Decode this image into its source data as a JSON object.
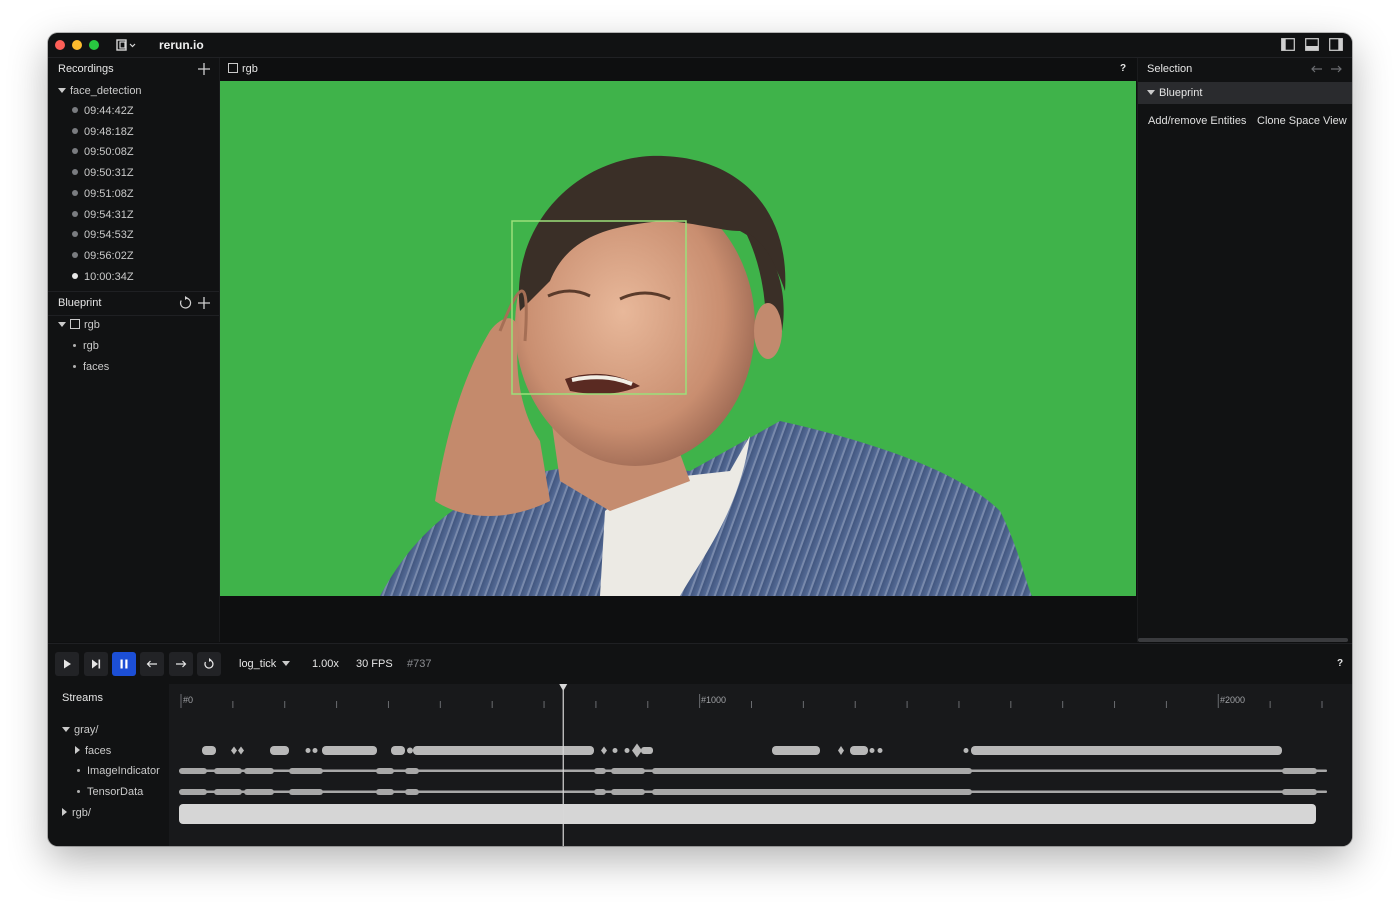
{
  "app": {
    "title": "rerun.io"
  },
  "recordings": {
    "header": "Recordings",
    "group": "face_detection",
    "items": [
      "09:44:42Z",
      "09:48:18Z",
      "09:50:08Z",
      "09:50:31Z",
      "09:51:08Z",
      "09:54:31Z",
      "09:54:53Z",
      "09:56:02Z",
      "10:00:34Z"
    ],
    "active_index": 8
  },
  "blueprint": {
    "header": "Blueprint",
    "space_view": "rgb",
    "entities": [
      "rgb",
      "faces"
    ]
  },
  "view": {
    "tab_label": "rgb",
    "help": "?",
    "image": {
      "background": "#3fb34a",
      "box_color": "#9be07a"
    }
  },
  "selection": {
    "header": "Selection",
    "blueprint_label": "Blueprint",
    "actions": [
      "Add/remove Entities",
      "Clone Space View"
    ]
  },
  "controls": {
    "timeline": "log_tick",
    "speed": "1.00x",
    "fps": "30 FPS",
    "frame": "#737",
    "help": "?"
  },
  "streams": {
    "header": "Streams",
    "tree": [
      {
        "label": "gray/",
        "kind": "group-open"
      },
      {
        "label": "faces",
        "kind": "child-group"
      },
      {
        "label": "ImageIndicator",
        "kind": "leaf"
      },
      {
        "label": "TensorData",
        "kind": "leaf"
      },
      {
        "label": "rgb/",
        "kind": "group-closed"
      }
    ],
    "ticks": [
      "#0",
      "#1000",
      "#2000"
    ],
    "range": [
      0,
      2200
    ],
    "cursor": 737
  },
  "colors": {
    "accent": "#1c4fd6",
    "panel": "#111213",
    "text": "#cacaca"
  }
}
